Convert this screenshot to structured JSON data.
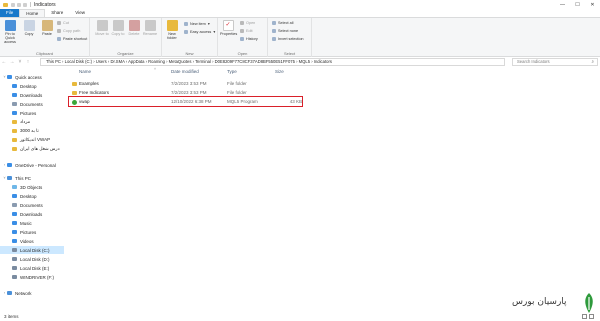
{
  "window": {
    "title": "Indicators",
    "controls": [
      "—",
      "☐",
      "✕"
    ]
  },
  "ribbon_tabs": [
    {
      "label": "File"
    },
    {
      "label": "Home"
    },
    {
      "label": "Share"
    },
    {
      "label": "View"
    }
  ],
  "ribbon": {
    "clipboard": {
      "pin": "Pin to Quick access",
      "copy": "Copy",
      "paste": "Paste",
      "cut": "Cut",
      "copy_path": "Copy path",
      "paste_shortcut": "Paste shortcut",
      "group": "Clipboard"
    },
    "organize": {
      "move_to": "Move to",
      "copy_to": "Copy to",
      "delete": "Delete",
      "rename": "Rename",
      "group": "Organize"
    },
    "new": {
      "new_folder": "New folder",
      "new_item": "New item",
      "easy_access": "Easy access",
      "group": "New"
    },
    "open": {
      "properties": "Properties",
      "open": "Open",
      "edit": "Edit",
      "history": "History",
      "group": "Open"
    },
    "select": {
      "select_all": "Select all",
      "select_none": "Select none",
      "invert": "Invert selection",
      "group": "Select"
    }
  },
  "address": {
    "path": "This PC  ›  Local Disk (C:)  ›  Users  ›  Dr.SMA  ›  AppData  ›  Roaming  ›  MetaQuotes  ›  Terminal  ›  D0E8209F77C8CF37AD8BF550E51FF075  ›  MQL5  ›  Indicators",
    "search_placeholder": "Search Indicators"
  },
  "nav": {
    "quick_access": "Quick access",
    "desktop": "Desktop",
    "downloads": "Downloads",
    "documents": "Documents",
    "pictures": "Pictures",
    "fa1": "مرداد",
    "fa2": "3000 تا به",
    "fa3": "اندیکاتور VWAP",
    "fa4": "درس شغل های ایران",
    "onedrive": "OneDrive - Personal",
    "this_pc": "This PC",
    "objects3d": "3D Objects",
    "pc_desktop": "Desktop",
    "pc_documents": "Documents",
    "pc_downloads": "Downloads",
    "music": "Music",
    "pc_pictures": "Pictures",
    "videos": "Videos",
    "disk_c": "Local Disk (C:)",
    "disk_d": "Local Disk (D:)",
    "disk_e": "Local Disk (E:)",
    "windriver": "WINDRIVER (F:)",
    "network": "Network"
  },
  "columns": {
    "name": "Name",
    "date": "Date modified",
    "type": "Type",
    "size": "Size"
  },
  "files": [
    {
      "name": "Examples",
      "date": "7/2/2023 3:53 PM",
      "type": "File folder",
      "size": ""
    },
    {
      "name": "Free Indicators",
      "date": "7/2/2023 3:53 PM",
      "type": "File folder",
      "size": ""
    },
    {
      "name": "vwap",
      "date": "12/10/2022 6:38 PM",
      "type": "MQL5 Program",
      "size": "43 KB"
    }
  ],
  "status": {
    "items": "3 items"
  },
  "watermark": {
    "text": "پارسیان بورس"
  },
  "colors": {
    "accent": "#1979ca",
    "selection": "#cce8ff",
    "highlight_border": "#d9202a",
    "folder": "#e8b93c",
    "mql_icon": "#3aa83a"
  }
}
